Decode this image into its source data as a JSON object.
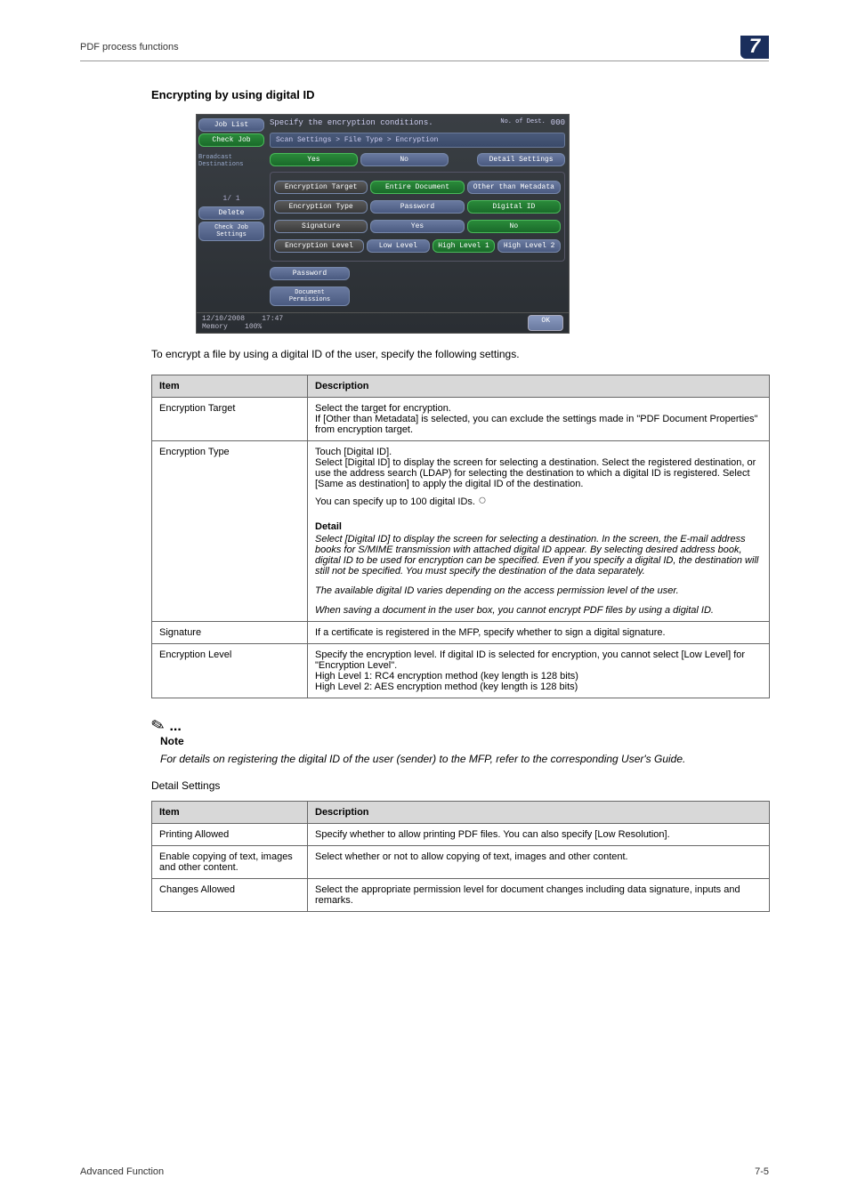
{
  "header": {
    "left": "PDF process functions",
    "chapter": "7"
  },
  "section_title": "Encrypting by using digital ID",
  "screenshot": {
    "top_instr": "Specify the encryption conditions.",
    "top_right_label": "No. of Dest.",
    "top_right_val": "000",
    "job_list": "Job List",
    "check_job": "Check Job",
    "broadcast": "Broadcast Destinations",
    "pager": "1/ 1",
    "delete": "Delete",
    "check_settings": "Check Job Settings",
    "breadcrumb": "Scan Settings > File Type > Encryption",
    "yes": "Yes",
    "no": "No",
    "detail_settings": "Detail Settings",
    "enc_target": "Encryption Target",
    "entire_doc": "Entire Document",
    "other_meta": "Other than Metadata",
    "enc_type": "Encryption Type",
    "password_btn": "Password",
    "digital_id": "Digital ID",
    "signature": "Signature",
    "enc_level": "Encryption Level",
    "low": "Low Level",
    "high1": "High Level 1",
    "high2": "High Level 2",
    "password_row": "Password",
    "doc_perm": "Document Permissions",
    "status_date": "12/10/2008",
    "status_time": "17:47",
    "status_mem": "Memory",
    "status_mem_val": "100%",
    "ok": "OK"
  },
  "lead_text": "To encrypt a file by using a digital ID of the user, specify the following settings.",
  "table1": {
    "h1": "Item",
    "h2": "Description",
    "rows": [
      {
        "item": "Encryption Target",
        "desc": "Select the target for encryption.\nIf [Other than Metadata] is selected, you can exclude the settings made in \"PDF Document Properties\" from encryption target."
      },
      {
        "item": "Encryption Type",
        "desc_main": "Touch [Digital ID].\nSelect [Digital ID] to display the screen for selecting a destination. Select the registered destination, or use the address search (LDAP) for selecting the destination to which a digital ID is registered. Select [Same as destination] to apply the digital ID of the destination.\nYou can specify up to 100 digital IDs.",
        "detail_label": "Detail",
        "detail_1": "Select [Digital ID] to display the screen for selecting a destination. In the screen, the E-mail address books for S/MIME transmission with attached digital ID appear. By selecting desired address book, digital ID to be used for encryption can be specified. Even if you specify a digital ID, the destination will still not be specified. You must specify the destination of the data separately.",
        "detail_2": "The available digital ID varies depending on the access permission level of the user.",
        "detail_3": "When saving a document in the user box, you cannot encrypt PDF files by using a digital ID."
      },
      {
        "item": "Signature",
        "desc": "If a certificate is registered in the MFP, specify whether to sign a digital signature."
      },
      {
        "item": "Encryption Level",
        "desc": "Specify the encryption level. If digital ID is selected for encryption, you cannot select [Low Level] for \"Encryption Level\".\nHigh Level 1: RC4 encryption method (key length is 128 bits)\nHigh Level 2: AES encryption method (key length is 128 bits)"
      }
    ]
  },
  "note": {
    "dots": "...",
    "title": "Note",
    "text": "For details on registering the digital ID of the user (sender) to the MFP, refer to the corresponding User's Guide."
  },
  "sub_heading": "Detail Settings",
  "table2": {
    "h1": "Item",
    "h2": "Description",
    "rows": [
      {
        "item": "Printing Allowed",
        "desc": "Specify whether to allow printing PDF files. You can also specify [Low Resolution]."
      },
      {
        "item": "Enable copying of text, images and other content.",
        "desc": "Select whether or not to allow copying of text, images and other content."
      },
      {
        "item": "Changes Allowed",
        "desc": "Select the appropriate permission level for document changes including data signature, inputs and remarks."
      }
    ]
  },
  "footer": {
    "left": "Advanced Function",
    "right": "7-5"
  }
}
